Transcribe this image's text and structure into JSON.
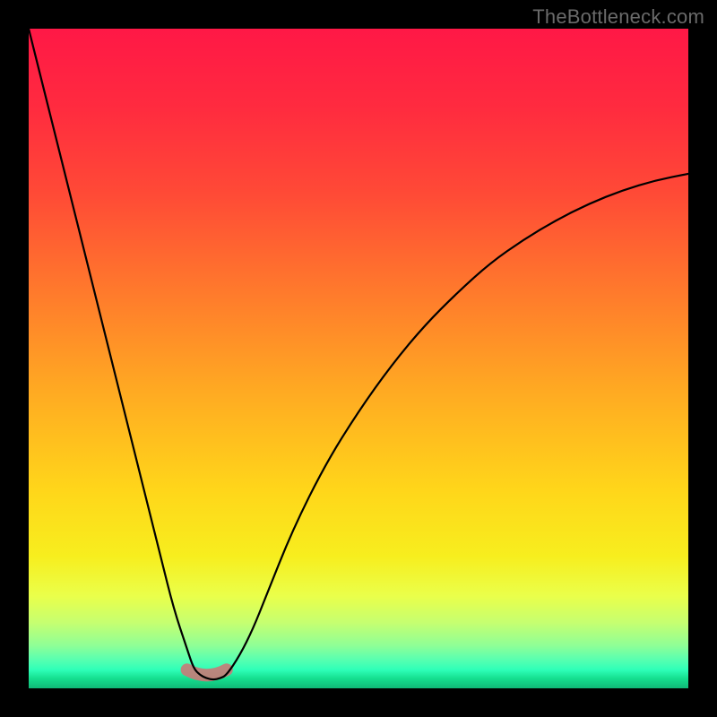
{
  "watermark": {
    "text": "TheBottleneck.com"
  },
  "colors": {
    "frame_bg": "#000000",
    "gradient_stops": [
      {
        "offset": 0.0,
        "color": "#ff1846"
      },
      {
        "offset": 0.12,
        "color": "#ff2b3f"
      },
      {
        "offset": 0.25,
        "color": "#ff4a36"
      },
      {
        "offset": 0.4,
        "color": "#ff7a2c"
      },
      {
        "offset": 0.55,
        "color": "#ffaa22"
      },
      {
        "offset": 0.7,
        "color": "#ffd61a"
      },
      {
        "offset": 0.8,
        "color": "#f7ee1e"
      },
      {
        "offset": 0.86,
        "color": "#eaff4a"
      },
      {
        "offset": 0.9,
        "color": "#c6ff70"
      },
      {
        "offset": 0.935,
        "color": "#8fff96"
      },
      {
        "offset": 0.955,
        "color": "#5cffaf"
      },
      {
        "offset": 0.972,
        "color": "#2effb8"
      },
      {
        "offset": 0.985,
        "color": "#15df8f"
      },
      {
        "offset": 1.0,
        "color": "#10b877"
      }
    ],
    "curve_stroke": "#000000",
    "soft_band": "#c97a78"
  },
  "chart_data": {
    "type": "line",
    "title": "",
    "xlabel": "",
    "ylabel": "",
    "xlim": [
      0,
      100
    ],
    "ylim": [
      0,
      100
    ],
    "grid": false,
    "legend": false,
    "annotations": [
      "TheBottleneck.com"
    ],
    "series": [
      {
        "name": "bottleneck-curve",
        "x": [
          0,
          2,
          4,
          6,
          8,
          10,
          12,
          14,
          16,
          18,
          20,
          22,
          24,
          25,
          26,
          27,
          28,
          29,
          30,
          32,
          34,
          36,
          40,
          45,
          50,
          55,
          60,
          65,
          70,
          75,
          80,
          85,
          90,
          95,
          100
        ],
        "y": [
          100,
          92,
          84,
          76,
          68,
          60,
          52,
          44,
          36,
          28,
          20,
          12,
          6,
          3,
          2,
          1.5,
          1.3,
          1.5,
          2,
          5,
          9,
          14,
          24,
          34,
          42,
          49,
          55,
          60,
          64.5,
          68,
          71,
          73.5,
          75.5,
          77,
          78
        ]
      }
    ],
    "highlight_band": {
      "name": "optimal-zone",
      "x_range": [
        24,
        30
      ],
      "y_level": 2,
      "thickness_px": 14
    }
  }
}
